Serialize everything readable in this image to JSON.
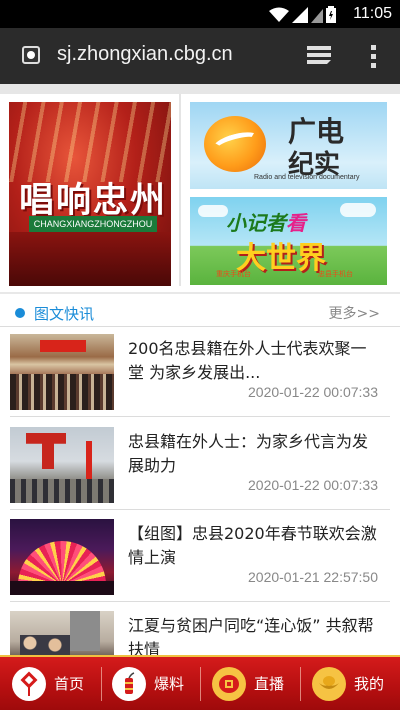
{
  "status_bar": {
    "time": "11:05"
  },
  "browser": {
    "url": "sj.zhongxian.cbg.cn",
    "icons": [
      "favicon-icon",
      "tabs-icon",
      "overflow-menu-icon"
    ]
  },
  "banners": {
    "left": {
      "title": "唱响忠州",
      "subtitle": "CHANGXIANGZHONGZHOU"
    },
    "right_top": {
      "line1": "广电",
      "line2": "纪实",
      "caption": "Radio and television documentary"
    },
    "right_bottom": {
      "line1_pre": "小记者",
      "line1_accent": "看",
      "line2": "大世界",
      "left_station": "重庆手机台",
      "right_station": "忠县手机台"
    }
  },
  "section": {
    "title": "图文快讯",
    "more": "更多>>"
  },
  "news": [
    {
      "title": "200名忠县籍在外人士代表欢聚一堂 为家乡发展出...",
      "date": "2020-01-22 00:07:33"
    },
    {
      "title": "忠县籍在外人士：为家乡代言为发展助力",
      "date": "2020-01-22 00:07:33"
    },
    {
      "title": "【组图】忠县2020年春节联欢会激情上演",
      "date": "2020-01-21 22:57:50"
    },
    {
      "title": "江夏与贫困户同吃“连心饭” 共叙帮扶情",
      "date": ""
    }
  ],
  "bottom_nav": {
    "items": [
      {
        "label": "首页",
        "icon": "chinese-knot-icon"
      },
      {
        "label": "爆料",
        "icon": "firecracker-icon"
      },
      {
        "label": "直播",
        "icon": "lantern-icon"
      },
      {
        "label": "我的",
        "icon": "gold-ingot-icon"
      }
    ]
  },
  "colors": {
    "accent_blue": "#1a8cd8",
    "nav_red": "#c41414",
    "url_bar": "#2b2b2b"
  }
}
